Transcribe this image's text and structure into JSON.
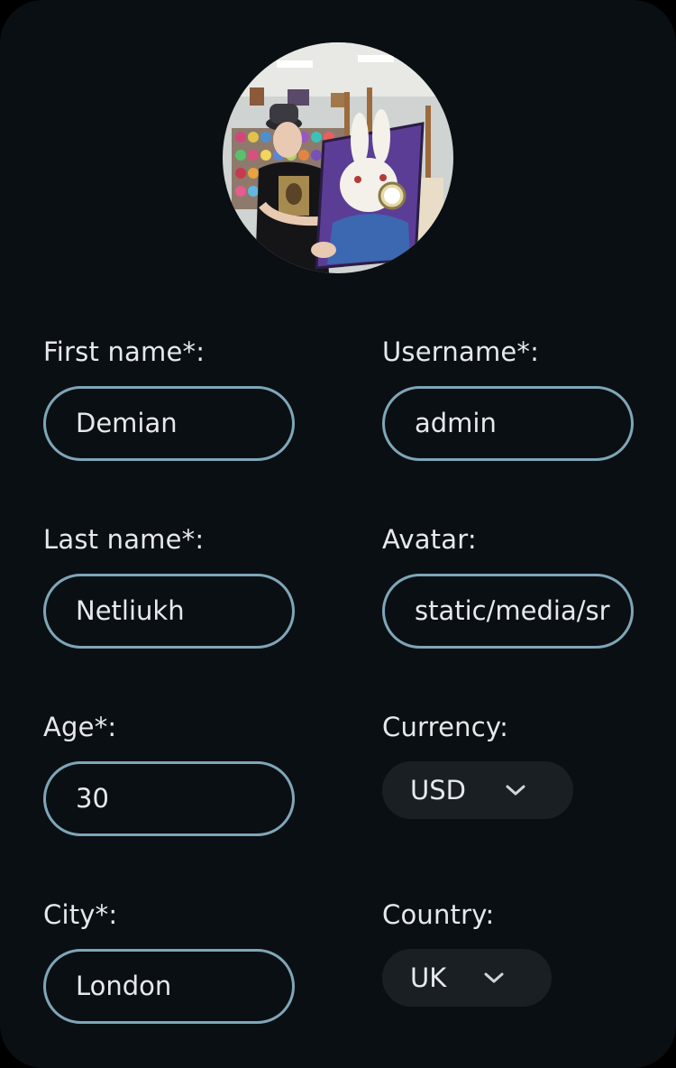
{
  "profile": {
    "avatar_alt": "profile avatar",
    "fields": {
      "first_name": {
        "label": "First name*:",
        "value": "Demian"
      },
      "username": {
        "label": "Username*:",
        "value": "admin"
      },
      "last_name": {
        "label": "Last name*:",
        "value": "Netliukh"
      },
      "avatar": {
        "label": "Avatar:",
        "value": "static/media/sr"
      },
      "age": {
        "label": "Age*:",
        "value": "30"
      },
      "currency": {
        "label": "Currency:",
        "value": "USD"
      },
      "city": {
        "label": "City*:",
        "value": "London"
      },
      "country": {
        "label": "Country:",
        "value": "UK"
      }
    }
  },
  "icons": {
    "dropdown": "chevron-down-icon"
  },
  "colors": {
    "background": "#0a0f13",
    "input_border": "#7ea6b8",
    "select_bg": "#1a1f24",
    "text": "#e6e9ec"
  }
}
